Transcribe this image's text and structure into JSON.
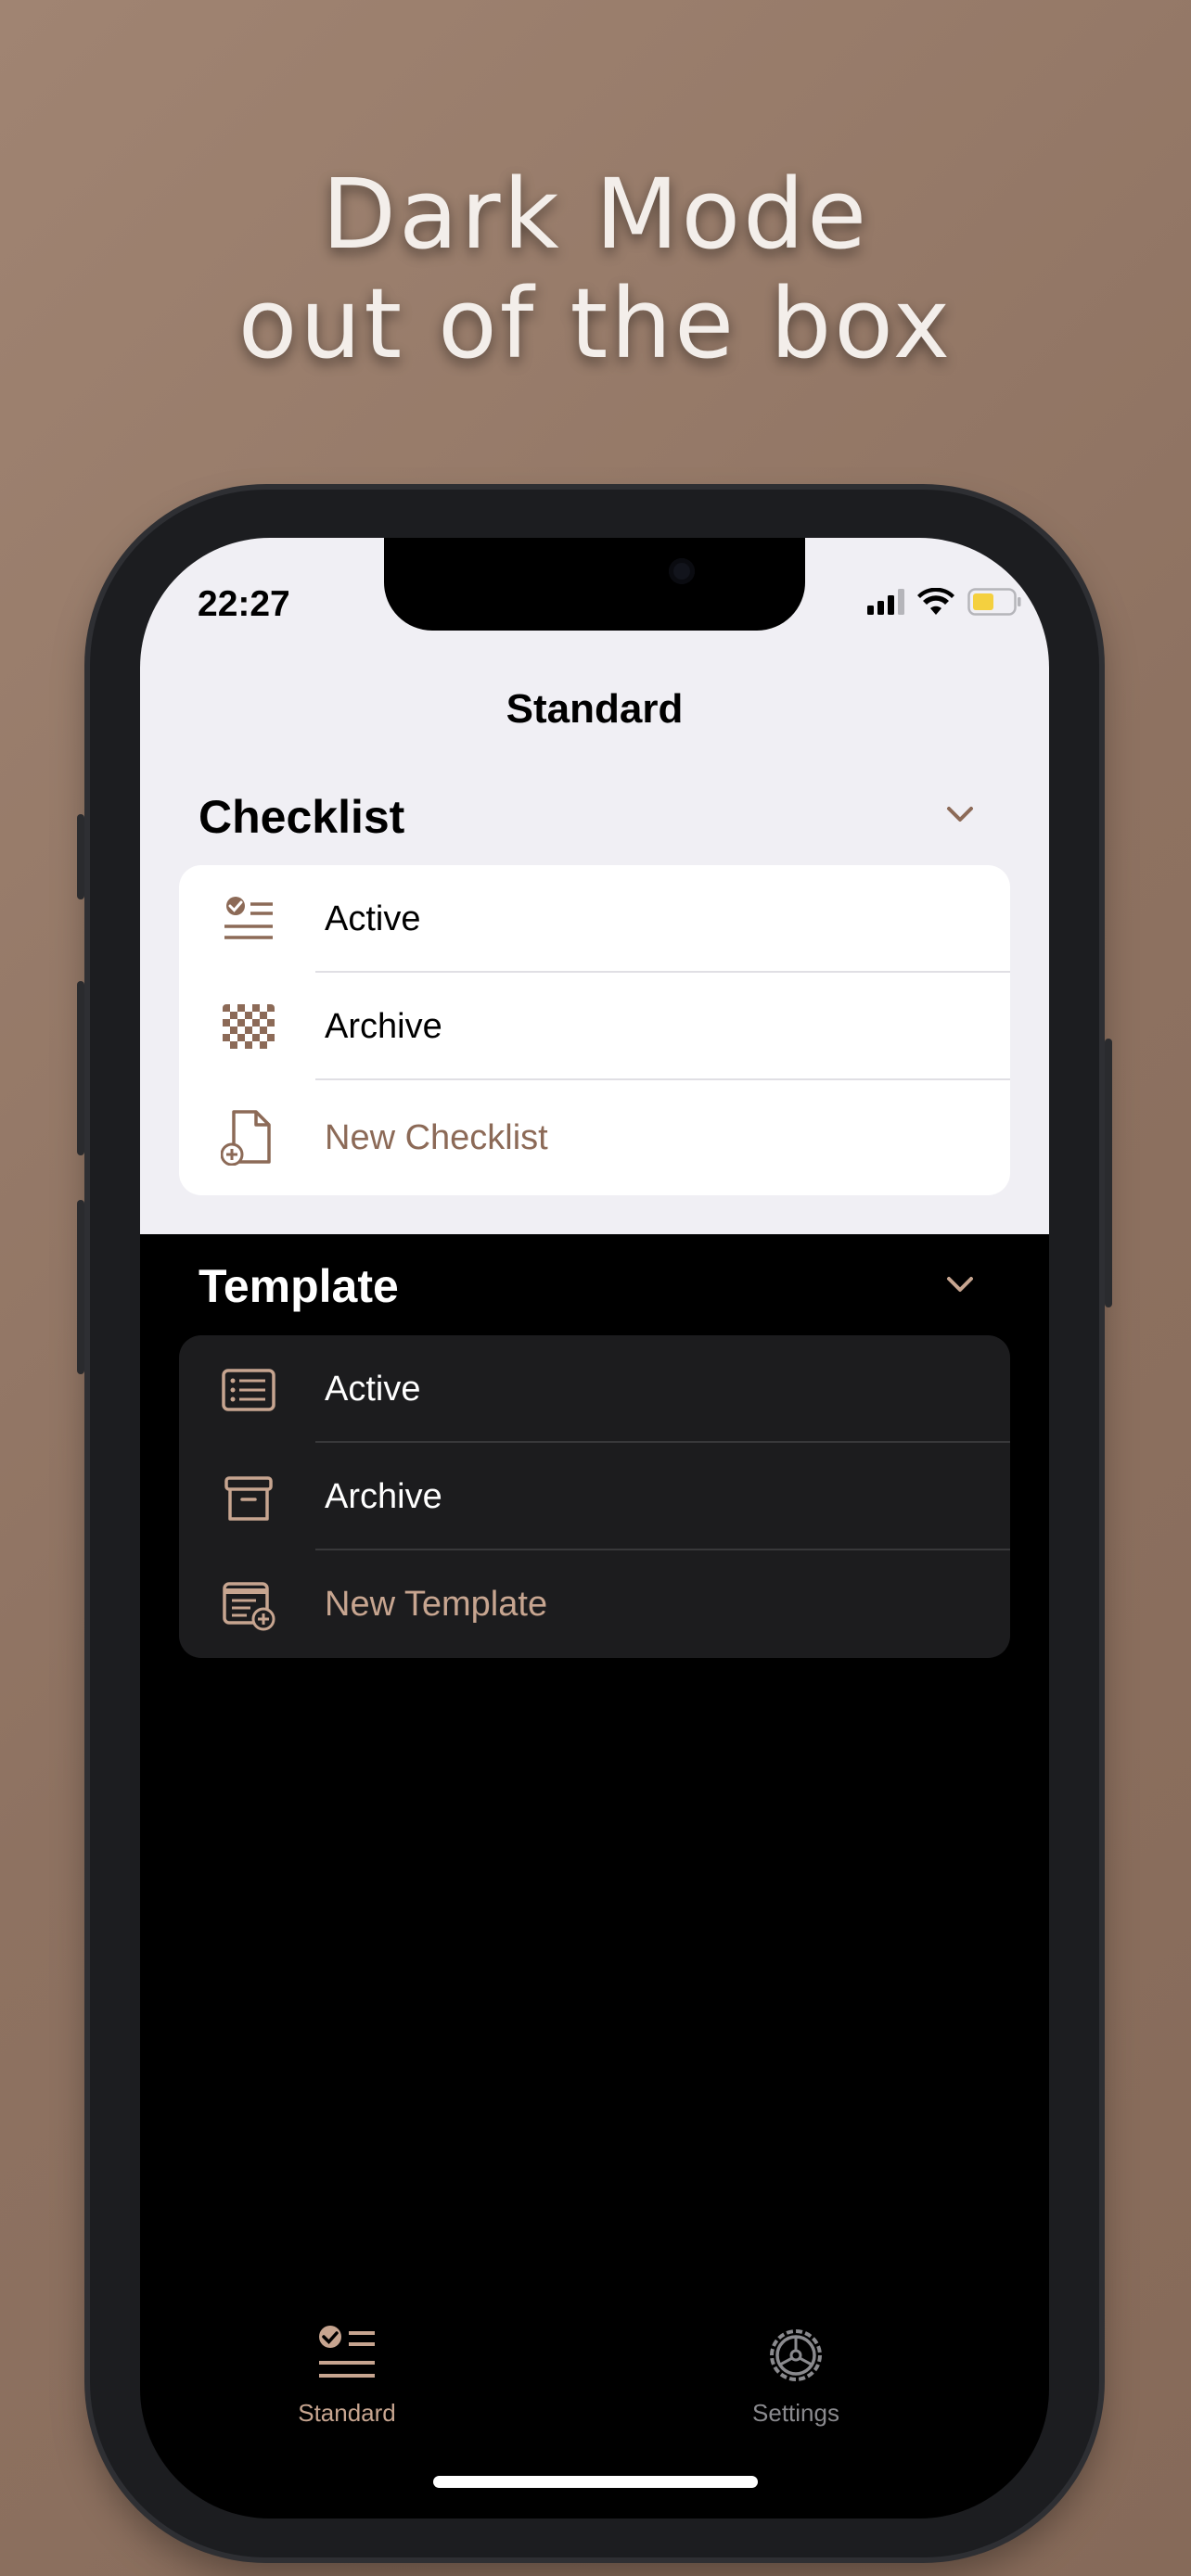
{
  "promo": {
    "line1": "Dark Mode",
    "line2": "out of the box"
  },
  "status_bar": {
    "time": "22:27",
    "battery_color": "#f4d03f"
  },
  "nav": {
    "title": "Standard"
  },
  "checklist": {
    "header": "Checklist",
    "items": [
      {
        "label": "Active",
        "icon": "checklist-icon"
      },
      {
        "label": "Archive",
        "icon": "checkerboard-icon"
      },
      {
        "label": "New Checklist",
        "icon": "new-document-icon"
      }
    ]
  },
  "template": {
    "header": "Template",
    "items": [
      {
        "label": "Active",
        "icon": "list-icon"
      },
      {
        "label": "Archive",
        "icon": "archive-box-icon"
      },
      {
        "label": "New Template",
        "icon": "new-template-icon"
      }
    ]
  },
  "tabbar": {
    "tabs": [
      {
        "label": "Standard",
        "icon": "checklist-icon",
        "selected": true
      },
      {
        "label": "Settings",
        "icon": "gear-icon",
        "selected": false
      }
    ]
  },
  "colors": {
    "accent": "#8c6a57",
    "accent_dark_mode": "#c7a590",
    "light_bg": "#f0eff4",
    "dark_card": "#1c1c1e"
  }
}
